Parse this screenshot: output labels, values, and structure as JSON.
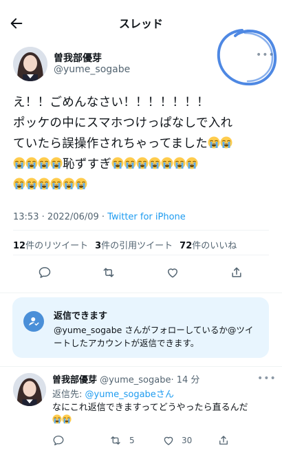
{
  "header": {
    "title": "スレッド",
    "back_icon": "arrow-left-icon"
  },
  "tweet": {
    "author_name": "曽我部優芽",
    "author_handle": "@yume_sogabe",
    "text_line1": "え！！ごめんなさい！！！！！！！",
    "text_line2": "ポッケの中にスマホつけっぱなしで入れ",
    "text_line3_prefix": "ていたら誤操作されちゃってました",
    "text_line4_suffix": "恥ずすぎ",
    "time": "13:53 · 2022/06/09 · ",
    "source": "Twitter for iPhone",
    "stats": {
      "retweets_count": "12",
      "retweets_label": "件のリツイート",
      "quotes_count": "3",
      "quotes_label": "件の引用ツイート",
      "likes_count": "72",
      "likes_label": "件のいいね"
    }
  },
  "reply_notice": {
    "title": "返信できます",
    "body": "@yume_sogabe さんがフォローしているか@ツイートしたアカウントが返信できます。"
  },
  "reply": {
    "author_name": "曽我部優芽",
    "author_handle": "@yume_sogabe",
    "time": "· 14 分",
    "reply_to_label": "返信先: ",
    "reply_to_handle": "@yume_sogabe",
    "reply_to_suffix": "さん",
    "text": "なにこれ返信できますってどうやったら直るんだ",
    "retweets": "5",
    "likes": "30"
  },
  "colors": {
    "accent": "#1d9bf0",
    "annotation": "#3b7be0",
    "notice_bg": "#e8f5fe"
  }
}
